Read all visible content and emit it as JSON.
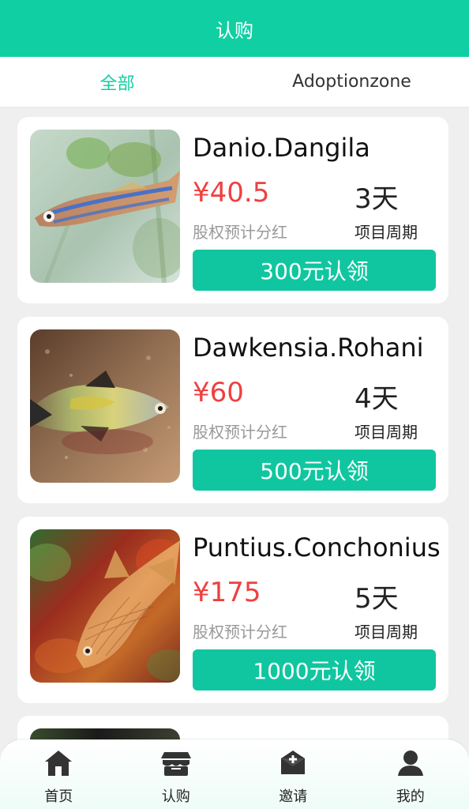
{
  "header": {
    "title": "认购"
  },
  "tabs": [
    {
      "label": "全部",
      "active": true
    },
    {
      "label": "Adoptionzone",
      "active": false
    }
  ],
  "products": [
    {
      "name": "Danio.Dangila",
      "price": "¥40.5",
      "price_label": "股权预计分红",
      "period": "3天",
      "period_label": "项目周期",
      "button_label": "300元认领"
    },
    {
      "name": "Dawkensia.Rohani",
      "price": "¥60",
      "price_label": "股权预计分红",
      "period": "4天",
      "period_label": "项目周期",
      "button_label": "500元认领"
    },
    {
      "name": "Puntius.Conchonius",
      "price": "¥175",
      "price_label": "股权预计分红",
      "period": "5天",
      "period_label": "项目周期",
      "button_label": "1000元认领"
    }
  ],
  "nav": {
    "items": [
      {
        "label": "首页",
        "icon": "home-icon"
      },
      {
        "label": "认购",
        "icon": "store-icon"
      },
      {
        "label": "邀请",
        "icon": "invite-icon"
      },
      {
        "label": "我的",
        "icon": "user-icon"
      }
    ]
  },
  "colors": {
    "accent": "#10cfa3",
    "price": "#ef4040",
    "secondary_text": "#999999"
  }
}
